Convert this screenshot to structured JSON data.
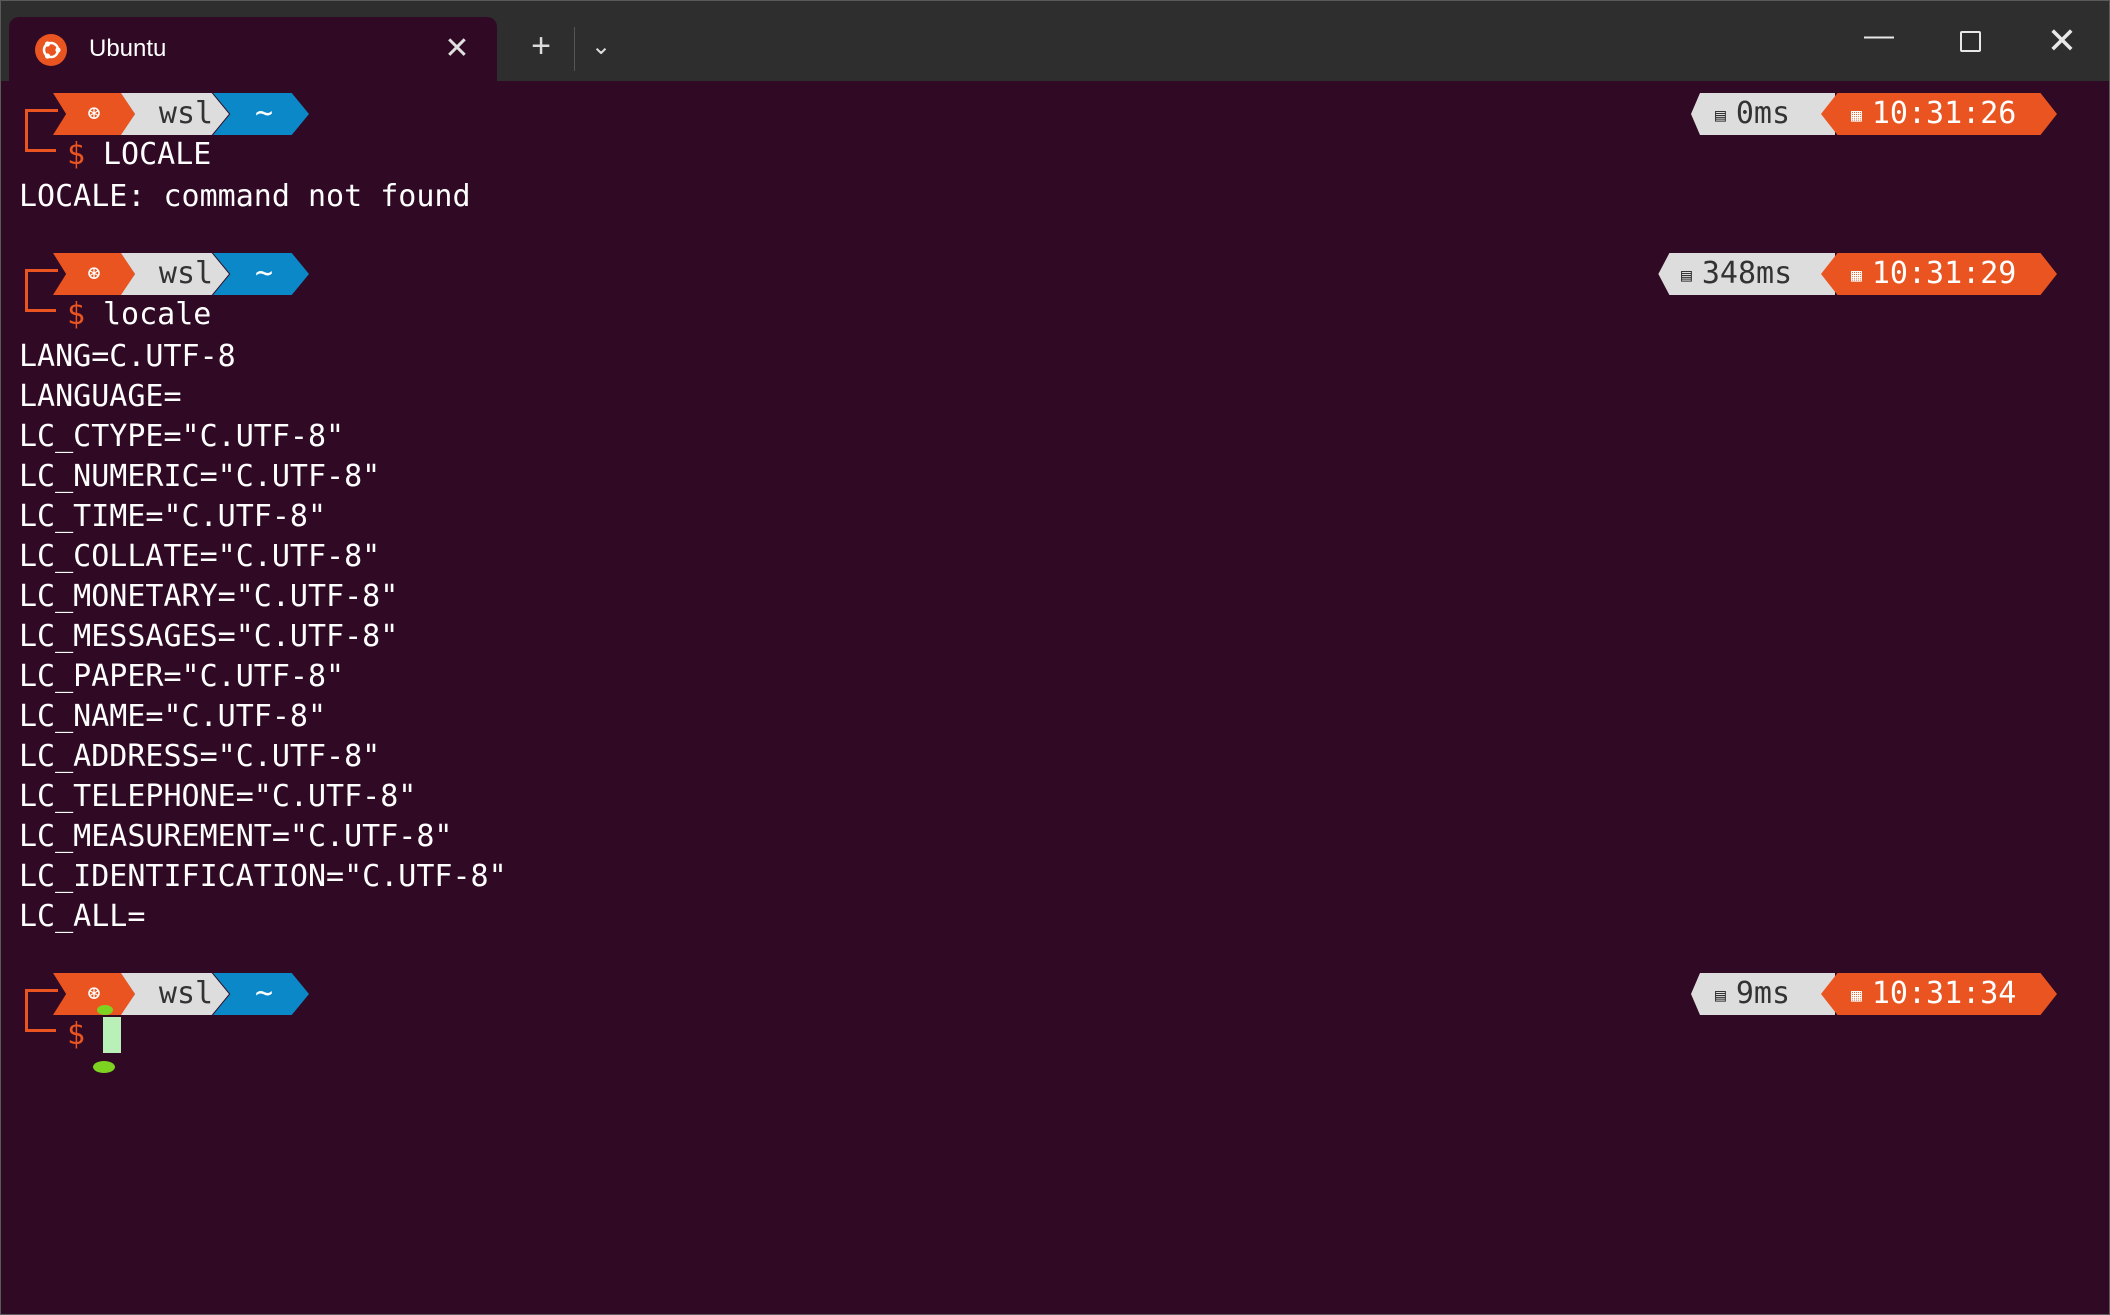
{
  "window": {
    "tab_title": "Ubuntu",
    "tab_icon": "ubuntu-logo-icon",
    "close_tab_glyph": "✕",
    "new_tab_glyph": "+",
    "dropdown_glyph": "⌄",
    "minimize_glyph": "—",
    "close_glyph": "✕",
    "colors": {
      "titlebar": "#2e2e2e",
      "terminal_bg": "#300a24",
      "accent": "#e95420",
      "path_blue": "#0a88c7"
    }
  },
  "prompt": {
    "logo_icon": "ubuntu-logo-icon",
    "host": "wsl",
    "path": "~",
    "symbol": "$",
    "duration_icon": "stopwatch-icon",
    "time_icon": "calendar-icon"
  },
  "blocks": [
    {
      "command": "LOCALE",
      "duration": "0ms",
      "time": "10:31:26"
    },
    {
      "command": "locale",
      "duration": "348ms",
      "time": "10:31:29"
    },
    {
      "command": "",
      "duration": "9ms",
      "time": "10:31:34"
    }
  ],
  "output1": [
    "LOCALE: command not found"
  ],
  "output2": [
    "LANG=C.UTF-8",
    "LANGUAGE=",
    "LC_CTYPE=\"C.UTF-8\"",
    "LC_NUMERIC=\"C.UTF-8\"",
    "LC_TIME=\"C.UTF-8\"",
    "LC_COLLATE=\"C.UTF-8\"",
    "LC_MONETARY=\"C.UTF-8\"",
    "LC_MESSAGES=\"C.UTF-8\"",
    "LC_PAPER=\"C.UTF-8\"",
    "LC_NAME=\"C.UTF-8\"",
    "LC_ADDRESS=\"C.UTF-8\"",
    "LC_TELEPHONE=\"C.UTF-8\"",
    "LC_MEASUREMENT=\"C.UTF-8\"",
    "LC_IDENTIFICATION=\"C.UTF-8\"",
    "LC_ALL="
  ]
}
